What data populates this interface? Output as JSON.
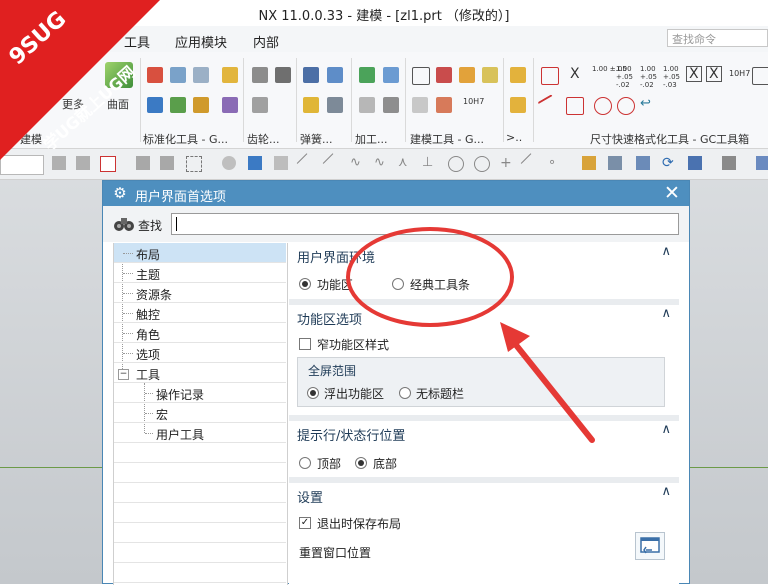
{
  "window": {
    "title": "NX 11.0.0.33 - 建模 - [zl1.prt （修改的）]"
  },
  "menubar": {
    "items": [
      "工具",
      "应用模块",
      "内部"
    ],
    "search_placeholder": "查找命令"
  },
  "ribbon": {
    "surface_label": "曲面",
    "more_label": "更多",
    "tenH7": "10H7",
    "groups": [
      "建模",
      "标准化工具 - G...",
      "齿轮...",
      "弹簧...",
      "加工...",
      "建模工具 - G...",
      ">..",
      "尺寸快速格式化工具 - GC工具箱"
    ],
    "tol_labels": [
      "1.00 ±.05",
      "1.00 +.05 -.02",
      "1.00 +.05 -.02",
      "1.00 +.05 -.03",
      "10H7"
    ]
  },
  "logo": {
    "line1": "9SUG",
    "line2": "学UG就上UG网"
  },
  "dialog": {
    "title": "用户界面首选项",
    "find_label": "查找",
    "tree": [
      {
        "label": "布局",
        "level": 0,
        "selected": true
      },
      {
        "label": "主题",
        "level": 0
      },
      {
        "label": "资源条",
        "level": 0
      },
      {
        "label": "触控",
        "level": 0
      },
      {
        "label": "角色",
        "level": 0
      },
      {
        "label": "选项",
        "level": 0
      },
      {
        "label": "工具",
        "level": 0,
        "expanded": true
      },
      {
        "label": "操作记录",
        "level": 1
      },
      {
        "label": "宏",
        "level": 1
      },
      {
        "label": "用户工具",
        "level": 1
      }
    ],
    "tree_expander": "−",
    "sections": {
      "ui_env": {
        "title": "用户界面环境",
        "options": [
          {
            "label": "功能区",
            "selected": true
          },
          {
            "label": "经典工具条",
            "selected": false
          }
        ]
      },
      "ribbon_opts": {
        "title": "功能区选项",
        "narrow_label": "窄功能区样式",
        "narrow_checked": false,
        "fullscreen_title": "全屏范围",
        "fullscreen_options": [
          {
            "label": "浮出功能区",
            "selected": true
          },
          {
            "label": "无标题栏",
            "selected": false
          }
        ]
      },
      "prompt_pos": {
        "title": "提示行/状态行位置",
        "options": [
          {
            "label": "顶部",
            "selected": false
          },
          {
            "label": "底部",
            "selected": true
          }
        ]
      },
      "settings": {
        "title": "设置",
        "save_layout_label": "退出时保存布局",
        "save_layout_checked": true,
        "reset_window_label": "重置窗口位置"
      }
    },
    "chevron": "∧",
    "check_mark": "✓"
  },
  "colors": {
    "dialog_title_bg": "#4e8fbf",
    "selection_bg": "#cde3f5",
    "logo_red": "#e02020",
    "annotation_red": "#e53935"
  }
}
